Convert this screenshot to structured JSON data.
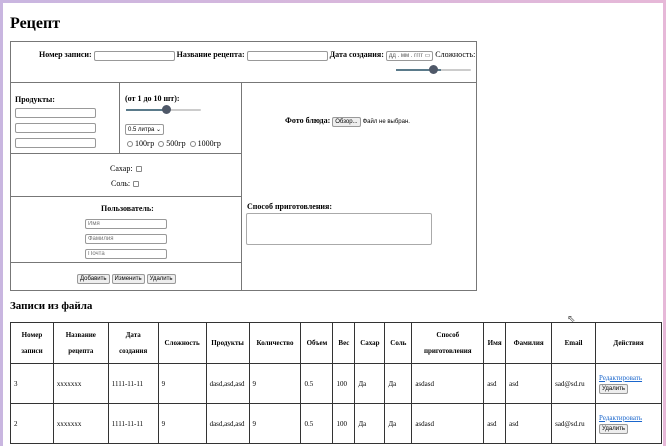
{
  "title": "Рецепт",
  "form": {
    "record_number_label": "Номер записи:",
    "recipe_name_label": "Название рецепта:",
    "date_label": "Дата создания:",
    "date_placeholder": "дд . мм . гггг",
    "difficulty_label": "Сложность:",
    "difficulty_value": 0.6,
    "products_label": "Продукты:",
    "quantity_label": "(от 1 до 10 шт):",
    "quantity_value": 0.55,
    "volume_select": "0.5 литра",
    "weights": [
      "100гр",
      "500гр",
      "1000гр"
    ],
    "photo_label": "Фото блюда:",
    "browse_button": "Обзор...",
    "no_file": "Файл не выбран.",
    "sugar_label": "Сахар:",
    "salt_label": "Соль:",
    "user_label": "Пользователь:",
    "first_name_placeholder": "Имя",
    "last_name_placeholder": "Фамилия",
    "email_placeholder": "Почта",
    "method_label": "Способ приготовления:",
    "add_button": "Добавить",
    "edit_button": "Изменить",
    "delete_button": "Удалить"
  },
  "records": {
    "title": "Записи из файла",
    "headers": [
      "Номер записи",
      "Название рецепта",
      "Дата создания",
      "Сложность",
      "Продукты",
      "Количество",
      "Объем",
      "Вес",
      "Сахар",
      "Соль",
      "Способ приготовления",
      "Имя",
      "Фамилия",
      "Email",
      "Действия"
    ],
    "rows": [
      [
        "3",
        "xxxxxxx",
        "1111-11-11",
        "9",
        "dasd,asd,asd",
        "9",
        "0.5",
        "100",
        "Да",
        "Да",
        "asdasd",
        "asd",
        "asd",
        "sad@sd.ru"
      ],
      [
        "2",
        "xxxxxxx",
        "1111-11-11",
        "9",
        "dasd,asd,asd",
        "9",
        "0.5",
        "100",
        "Да",
        "Да",
        "asdasd",
        "asd",
        "asd",
        "sad@sd.ru"
      ]
    ],
    "edit_link": "Редактировать",
    "delete_button": "Удалить"
  }
}
